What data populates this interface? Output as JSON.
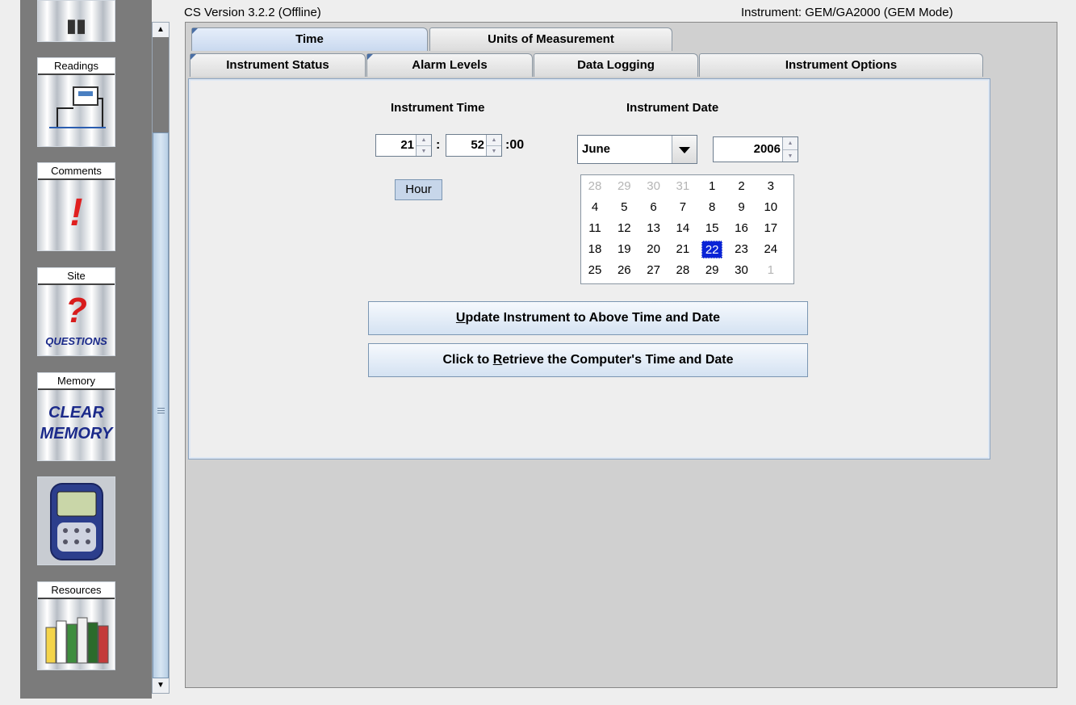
{
  "header": {
    "version": "CS Version 3.2.2 (Offline)",
    "instrument": "Instrument: GEM/GA2000 (GEM Mode)"
  },
  "sidebar": {
    "items": [
      {
        "label": "Readings",
        "icon": "readings-icon"
      },
      {
        "label": "Comments",
        "icon": "exclamation-icon"
      },
      {
        "label": "Site",
        "icon": "question-icon",
        "sub": "QUESTIONS"
      },
      {
        "label": "Memory",
        "icon": "clear-memory-icon",
        "sub1": "CLEAR",
        "sub2": "MEMORY"
      },
      {
        "label": "",
        "icon": "gas-analyser-device-icon"
      },
      {
        "label": "Resources",
        "icon": "books-icon"
      }
    ]
  },
  "tabs": {
    "row1": [
      {
        "label": "Time",
        "active": true
      },
      {
        "label": "Units of Measurement",
        "active": false
      }
    ],
    "row2": [
      {
        "label": "Instrument Status",
        "active": false
      },
      {
        "label": "Alarm Levels",
        "active": false
      },
      {
        "label": "Data Logging",
        "active": false
      },
      {
        "label": "Instrument Options",
        "active": false
      }
    ]
  },
  "time": {
    "heading": "Instrument Time",
    "hour": "21",
    "minute": "52",
    "second": ":00",
    "separator": ":",
    "field_label": "Hour"
  },
  "date": {
    "heading": "Instrument Date",
    "month": "June",
    "year": "2006",
    "calendar": {
      "weeks": [
        [
          "28",
          "29",
          "30",
          "31",
          "1",
          "2",
          "3"
        ],
        [
          "4",
          "5",
          "6",
          "7",
          "8",
          "9",
          "10"
        ],
        [
          "11",
          "12",
          "13",
          "14",
          "15",
          "16",
          "17"
        ],
        [
          "18",
          "19",
          "20",
          "21",
          "22",
          "23",
          "24"
        ],
        [
          "25",
          "26",
          "27",
          "28",
          "29",
          "30",
          "1"
        ]
      ],
      "selected": "22"
    }
  },
  "buttons": {
    "update_pre": "",
    "update_u": "U",
    "update_post": "pdate Instrument to Above Time and Date",
    "retrieve_pre": "Click to ",
    "retrieve_u": "R",
    "retrieve_post": "etrieve the Computer's Time and Date"
  }
}
